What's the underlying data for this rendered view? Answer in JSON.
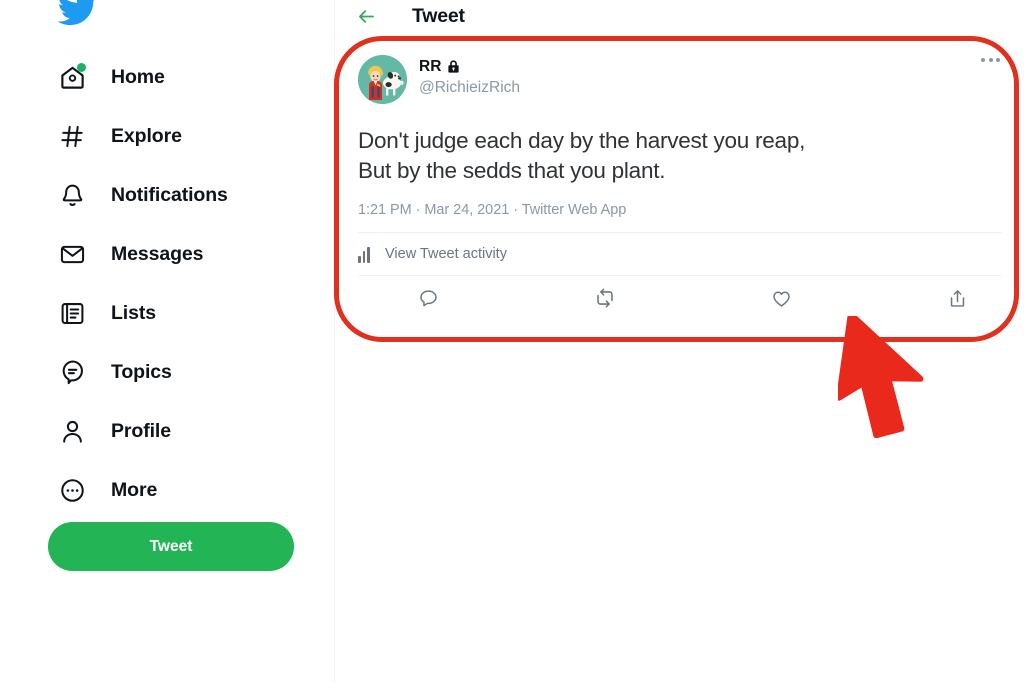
{
  "app": {
    "name": "Twitter",
    "logo_icon": "twitter-bird-icon"
  },
  "sidebar": {
    "items": [
      {
        "label": "Home",
        "icon": "home-icon",
        "badge": true
      },
      {
        "label": "Explore",
        "icon": "hashtag-icon",
        "badge": false
      },
      {
        "label": "Notifications",
        "icon": "bell-icon",
        "badge": false
      },
      {
        "label": "Messages",
        "icon": "envelope-icon",
        "badge": false
      },
      {
        "label": "Lists",
        "icon": "list-icon",
        "badge": false
      },
      {
        "label": "Topics",
        "icon": "topics-icon",
        "badge": false
      },
      {
        "label": "Profile",
        "icon": "person-icon",
        "badge": false
      },
      {
        "label": "More",
        "icon": "more-circle-icon",
        "badge": false
      }
    ],
    "tweet_button": {
      "label": "Tweet",
      "color": "#22b455"
    }
  },
  "header": {
    "back_icon": "back-arrow-icon",
    "title": "Tweet",
    "accent_color": "#34a853"
  },
  "tweet": {
    "avatar_icon": "user-avatar-image",
    "author_name": "RR",
    "protected_icon": "lock-icon",
    "author_handle": "@RichieizRich",
    "more_icon": "more-horizontal-icon",
    "text": "Don't judge each day by the harvest you reap,\nBut by the sedds that you plant.",
    "time": "1:21 PM",
    "date": "Mar 24, 2021",
    "source": "Twitter Web App",
    "meta_line": "1:21 PM · Mar 24, 2021 · Twitter Web App",
    "activity": {
      "icon": "bar-chart-icon",
      "label": "View Tweet activity"
    },
    "actions": [
      {
        "name": "reply",
        "icon": "reply-icon"
      },
      {
        "name": "retweet",
        "icon": "retweet-icon"
      },
      {
        "name": "like",
        "icon": "heart-icon"
      },
      {
        "name": "share",
        "icon": "share-icon"
      }
    ]
  },
  "annotations": {
    "highlight_color": "#e0301e",
    "cursor_color": "#e8291c",
    "highlight_shape": "rounded-rectangle",
    "cursor_icon": "mouse-pointer-arrow"
  }
}
